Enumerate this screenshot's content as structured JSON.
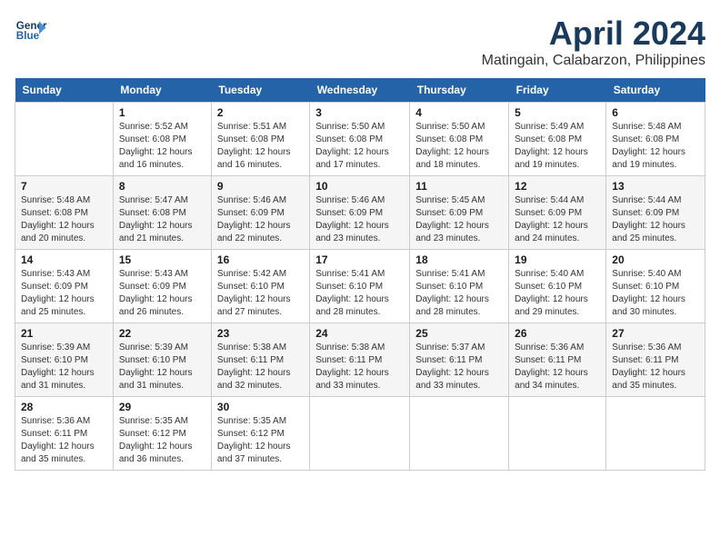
{
  "header": {
    "logo_line1": "General",
    "logo_line2": "Blue",
    "month_year": "April 2024",
    "location": "Matingain, Calabarzon, Philippines"
  },
  "weekdays": [
    "Sunday",
    "Monday",
    "Tuesday",
    "Wednesday",
    "Thursday",
    "Friday",
    "Saturday"
  ],
  "weeks": [
    [
      {
        "day": "",
        "info": ""
      },
      {
        "day": "1",
        "info": "Sunrise: 5:52 AM\nSunset: 6:08 PM\nDaylight: 12 hours and 16 minutes."
      },
      {
        "day": "2",
        "info": "Sunrise: 5:51 AM\nSunset: 6:08 PM\nDaylight: 12 hours and 16 minutes."
      },
      {
        "day": "3",
        "info": "Sunrise: 5:50 AM\nSunset: 6:08 PM\nDaylight: 12 hours and 17 minutes."
      },
      {
        "day": "4",
        "info": "Sunrise: 5:50 AM\nSunset: 6:08 PM\nDaylight: 12 hours and 18 minutes."
      },
      {
        "day": "5",
        "info": "Sunrise: 5:49 AM\nSunset: 6:08 PM\nDaylight: 12 hours and 19 minutes."
      },
      {
        "day": "6",
        "info": "Sunrise: 5:48 AM\nSunset: 6:08 PM\nDaylight: 12 hours and 19 minutes."
      }
    ],
    [
      {
        "day": "7",
        "info": "Sunrise: 5:48 AM\nSunset: 6:08 PM\nDaylight: 12 hours and 20 minutes."
      },
      {
        "day": "8",
        "info": "Sunrise: 5:47 AM\nSunset: 6:08 PM\nDaylight: 12 hours and 21 minutes."
      },
      {
        "day": "9",
        "info": "Sunrise: 5:46 AM\nSunset: 6:09 PM\nDaylight: 12 hours and 22 minutes."
      },
      {
        "day": "10",
        "info": "Sunrise: 5:46 AM\nSunset: 6:09 PM\nDaylight: 12 hours and 23 minutes."
      },
      {
        "day": "11",
        "info": "Sunrise: 5:45 AM\nSunset: 6:09 PM\nDaylight: 12 hours and 23 minutes."
      },
      {
        "day": "12",
        "info": "Sunrise: 5:44 AM\nSunset: 6:09 PM\nDaylight: 12 hours and 24 minutes."
      },
      {
        "day": "13",
        "info": "Sunrise: 5:44 AM\nSunset: 6:09 PM\nDaylight: 12 hours and 25 minutes."
      }
    ],
    [
      {
        "day": "14",
        "info": "Sunrise: 5:43 AM\nSunset: 6:09 PM\nDaylight: 12 hours and 25 minutes."
      },
      {
        "day": "15",
        "info": "Sunrise: 5:43 AM\nSunset: 6:09 PM\nDaylight: 12 hours and 26 minutes."
      },
      {
        "day": "16",
        "info": "Sunrise: 5:42 AM\nSunset: 6:10 PM\nDaylight: 12 hours and 27 minutes."
      },
      {
        "day": "17",
        "info": "Sunrise: 5:41 AM\nSunset: 6:10 PM\nDaylight: 12 hours and 28 minutes."
      },
      {
        "day": "18",
        "info": "Sunrise: 5:41 AM\nSunset: 6:10 PM\nDaylight: 12 hours and 28 minutes."
      },
      {
        "day": "19",
        "info": "Sunrise: 5:40 AM\nSunset: 6:10 PM\nDaylight: 12 hours and 29 minutes."
      },
      {
        "day": "20",
        "info": "Sunrise: 5:40 AM\nSunset: 6:10 PM\nDaylight: 12 hours and 30 minutes."
      }
    ],
    [
      {
        "day": "21",
        "info": "Sunrise: 5:39 AM\nSunset: 6:10 PM\nDaylight: 12 hours and 31 minutes."
      },
      {
        "day": "22",
        "info": "Sunrise: 5:39 AM\nSunset: 6:10 PM\nDaylight: 12 hours and 31 minutes."
      },
      {
        "day": "23",
        "info": "Sunrise: 5:38 AM\nSunset: 6:11 PM\nDaylight: 12 hours and 32 minutes."
      },
      {
        "day": "24",
        "info": "Sunrise: 5:38 AM\nSunset: 6:11 PM\nDaylight: 12 hours and 33 minutes."
      },
      {
        "day": "25",
        "info": "Sunrise: 5:37 AM\nSunset: 6:11 PM\nDaylight: 12 hours and 33 minutes."
      },
      {
        "day": "26",
        "info": "Sunrise: 5:36 AM\nSunset: 6:11 PM\nDaylight: 12 hours and 34 minutes."
      },
      {
        "day": "27",
        "info": "Sunrise: 5:36 AM\nSunset: 6:11 PM\nDaylight: 12 hours and 35 minutes."
      }
    ],
    [
      {
        "day": "28",
        "info": "Sunrise: 5:36 AM\nSunset: 6:11 PM\nDaylight: 12 hours and 35 minutes."
      },
      {
        "day": "29",
        "info": "Sunrise: 5:35 AM\nSunset: 6:12 PM\nDaylight: 12 hours and 36 minutes."
      },
      {
        "day": "30",
        "info": "Sunrise: 5:35 AM\nSunset: 6:12 PM\nDaylight: 12 hours and 37 minutes."
      },
      {
        "day": "",
        "info": ""
      },
      {
        "day": "",
        "info": ""
      },
      {
        "day": "",
        "info": ""
      },
      {
        "day": "",
        "info": ""
      }
    ]
  ]
}
